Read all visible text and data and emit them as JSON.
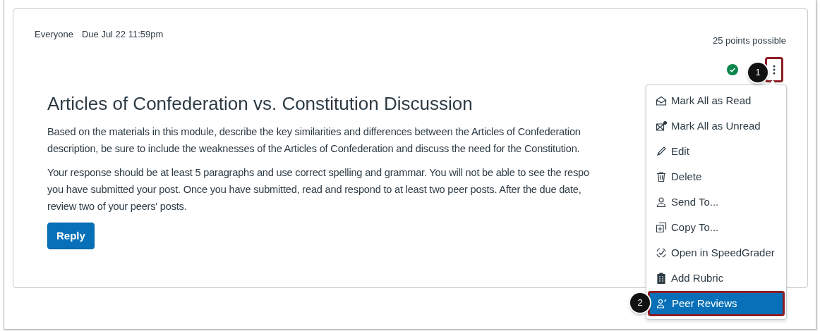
{
  "header": {
    "audience": "Everyone",
    "due": "Due Jul 22 11:59pm",
    "points": "25 points possible",
    "published": true
  },
  "title": "Articles of Confederation vs. Constitution Discussion",
  "paragraphs": [
    [
      "Based on the materials in this module, describe the key similarities and differences between the Articles of Confederation",
      "description, be sure to include the weaknesses of the Articles of Confederation and discuss the need for the Constitution."
    ],
    [
      "Your response should be at least 5 paragraphs and use correct spelling and grammar. You will not be able to see the respo",
      "you have submitted your post. Once you have submitted, read and respond to at least two peer posts. After the due date,",
      "review two of your peers' posts."
    ]
  ],
  "reply_button": "Reply",
  "menu": [
    {
      "kind": "read",
      "label": "Mark All as Read",
      "selected": false
    },
    {
      "kind": "unread",
      "label": "Mark All as Unread",
      "selected": false
    },
    {
      "kind": "edit",
      "label": "Edit",
      "selected": false
    },
    {
      "kind": "delete",
      "label": "Delete",
      "selected": false
    },
    {
      "kind": "send",
      "label": "Send To...",
      "selected": false
    },
    {
      "kind": "copy",
      "label": "Copy To...",
      "selected": false
    },
    {
      "kind": "speedgrader",
      "label": "Open in SpeedGrader",
      "selected": false
    },
    {
      "kind": "rubric",
      "label": "Add Rubric",
      "selected": false
    },
    {
      "kind": "peer",
      "label": "Peer Reviews",
      "selected": true
    }
  ],
  "callouts": [
    "1",
    "2"
  ]
}
